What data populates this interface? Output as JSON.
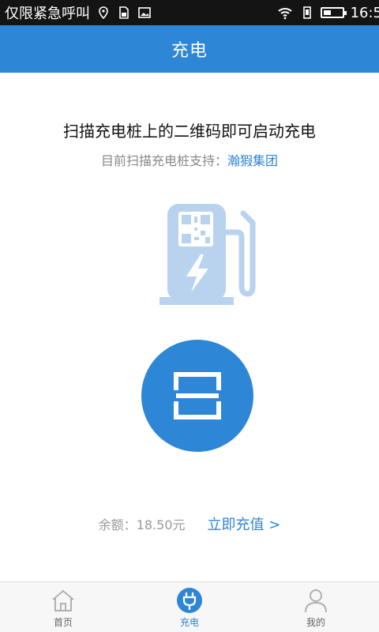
{
  "status_bar": {
    "carrier_text": "仅限紧急呼叫",
    "time": "16:5",
    "icons": [
      "location-icon",
      "sim-icon",
      "image-icon",
      "wifi-icon",
      "vibrate-icon",
      "battery-icon"
    ]
  },
  "header": {
    "title": "充电"
  },
  "main": {
    "instruction": "扫描充电桩上的二维码即可启动充电",
    "support_prefix": "目前扫描充电桩支持：",
    "support_link": "瀚猳集团",
    "balance_label": "余额：",
    "balance_value": "18.50元",
    "recharge_link": "立即充值 >"
  },
  "tabbar": {
    "items": [
      {
        "label": "首页",
        "icon": "home-icon",
        "active": false
      },
      {
        "label": "充电",
        "icon": "charge-plug-icon",
        "active": true
      },
      {
        "label": "我的",
        "icon": "user-icon",
        "active": false
      }
    ]
  },
  "colors": {
    "accent": "#2e86d6",
    "status_bar_bg": "#141414",
    "illustration_light_blue": "#b9d3ee"
  }
}
